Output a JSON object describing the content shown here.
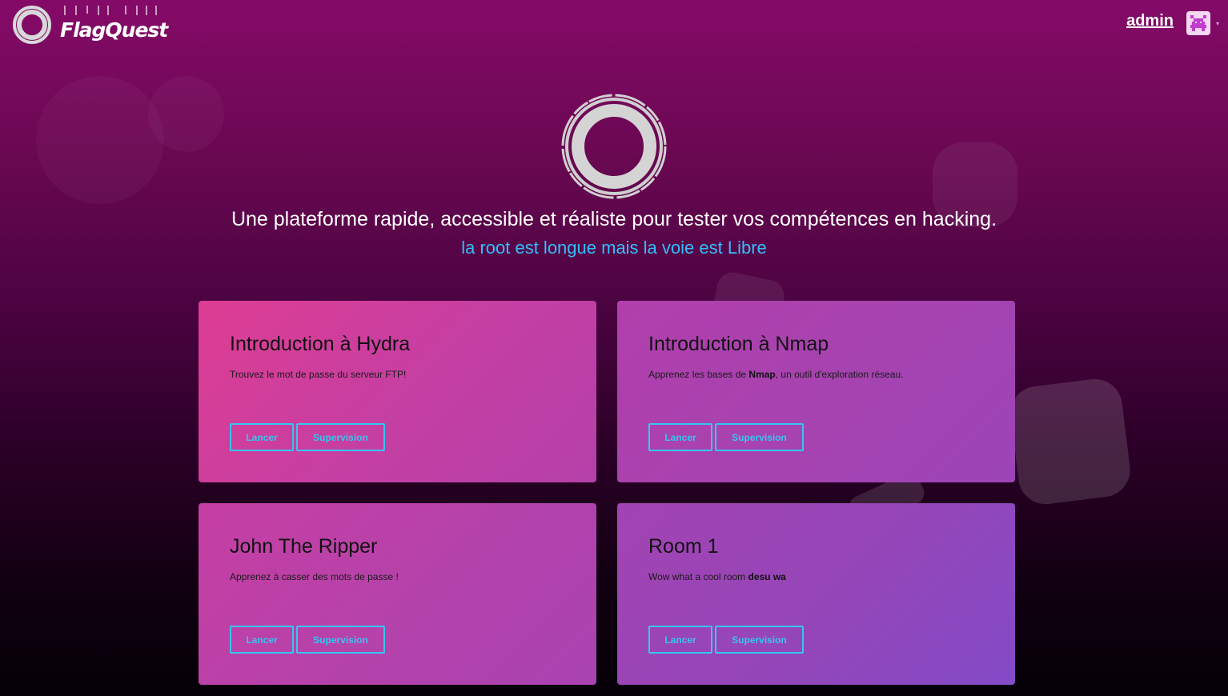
{
  "header": {
    "brand": "FlagQuest",
    "user_link": "admin"
  },
  "hero": {
    "tagline": "Une plateforme rapide, accessible et réaliste pour tester vos compétences en hacking.",
    "motto": "la root est longue mais la voie est Libre"
  },
  "colors": {
    "accent": "#35c6f0",
    "motto": "#33bfff",
    "background_top": "#850a68",
    "background_bottom": "#050007"
  },
  "rooms": [
    {
      "title": "Introduction à Hydra",
      "desc_pre": "Trouvez le mot de passe du serveur FTP!",
      "desc_bold": "",
      "desc_post": "",
      "launch_label": "Lancer",
      "supervision_label": "Supervision"
    },
    {
      "title": "Introduction à Nmap",
      "desc_pre": "Apprenez les bases de ",
      "desc_bold": "Nmap",
      "desc_post": ", un outil d'exploration réseau.",
      "launch_label": "Lancer",
      "supervision_label": "Supervision"
    },
    {
      "title": "John The Ripper",
      "desc_pre": "Apprenez à casser des mots de passe !",
      "desc_bold": "",
      "desc_post": "",
      "launch_label": "Lancer",
      "supervision_label": "Supervision"
    },
    {
      "title": "Room 1",
      "desc_pre": "Wow what a cool room ",
      "desc_bold": "desu wa",
      "desc_post": "",
      "launch_label": "Lancer",
      "supervision_label": "Supervision"
    }
  ]
}
